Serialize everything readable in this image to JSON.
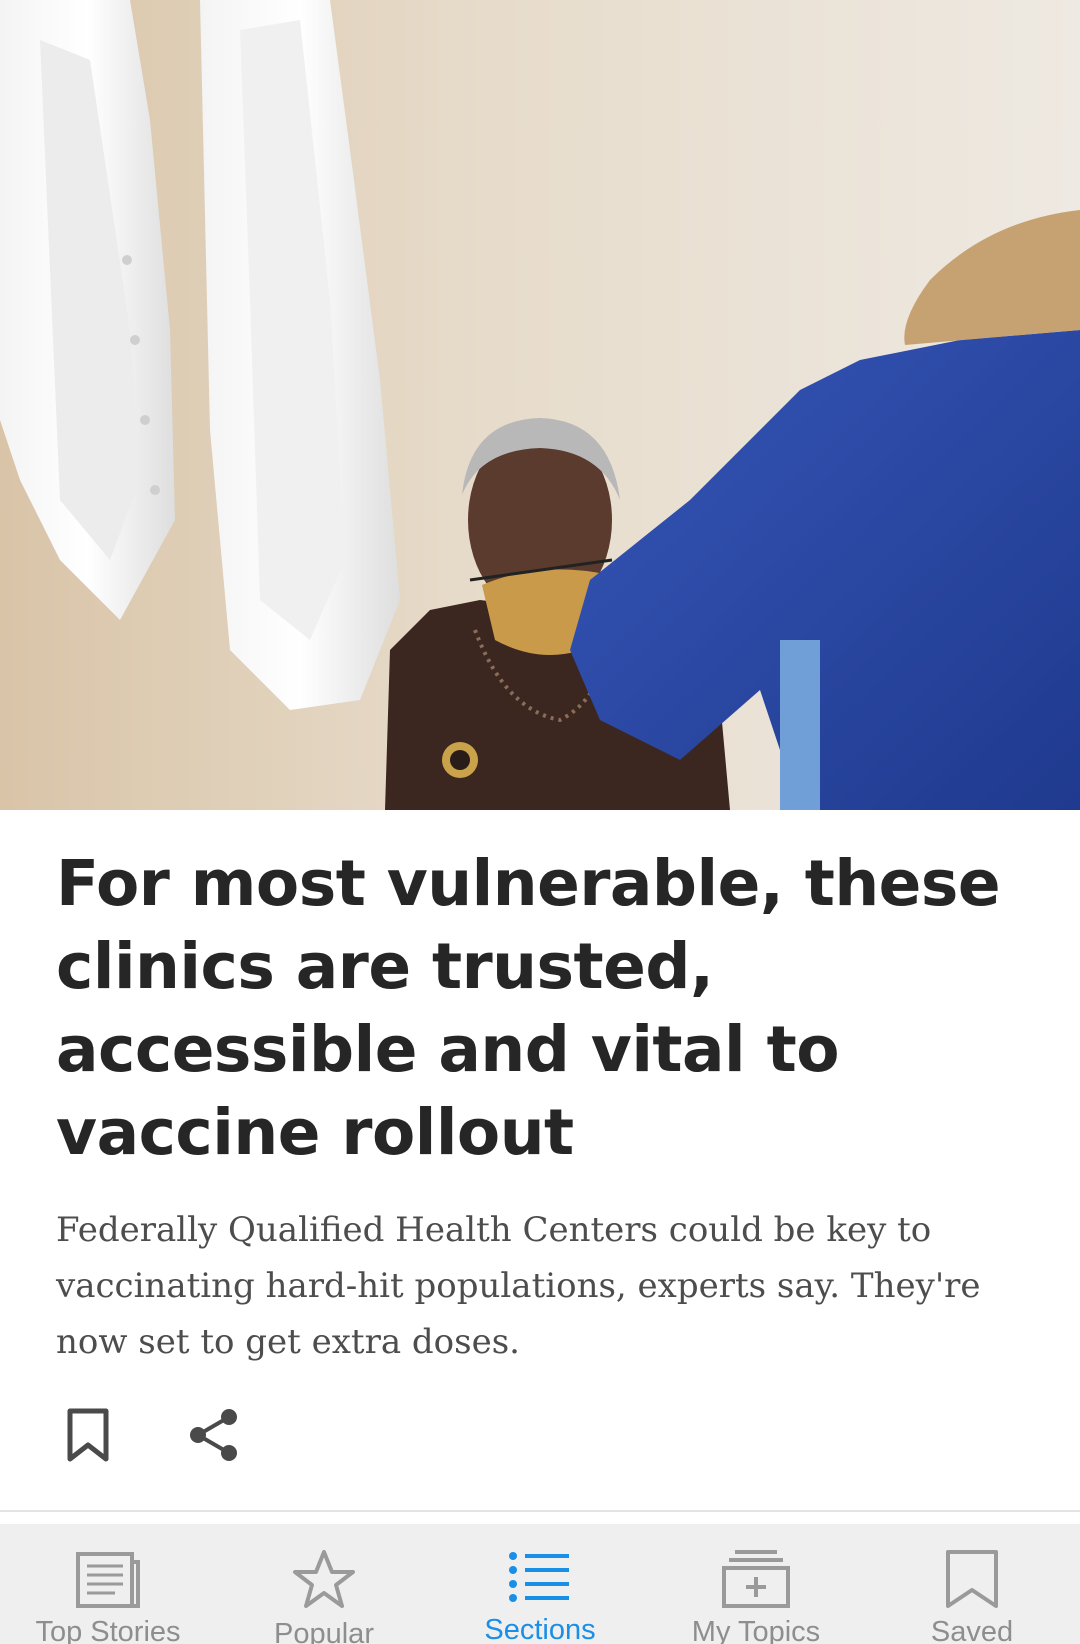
{
  "hero": {
    "icon": "photo"
  },
  "article": {
    "headline": "For most vulnerable, these clinics are trusted, accessible and vital to vaccine rollout",
    "summary": "Federally Qualified Health Centers could be key to vaccinating hard-hit populations, experts say. They're now set to get extra doses.",
    "actions": [
      {
        "icon": "bookmark-icon"
      },
      {
        "icon": "share-icon"
      }
    ]
  },
  "bottom_nav": {
    "active_color": "#1a8fe8",
    "inactive_color": "#8e8e8e",
    "items": [
      {
        "label": "Top Stories",
        "icon": "newspaper-icon",
        "active": false
      },
      {
        "label": "Popular",
        "icon": "star-icon",
        "active": false
      },
      {
        "label": "Sections",
        "icon": "list-icon",
        "active": true
      },
      {
        "label": "My Topics",
        "icon": "add-topics-icon",
        "active": false
      },
      {
        "label": "Saved",
        "icon": "bookmark-icon",
        "active": false
      }
    ]
  }
}
